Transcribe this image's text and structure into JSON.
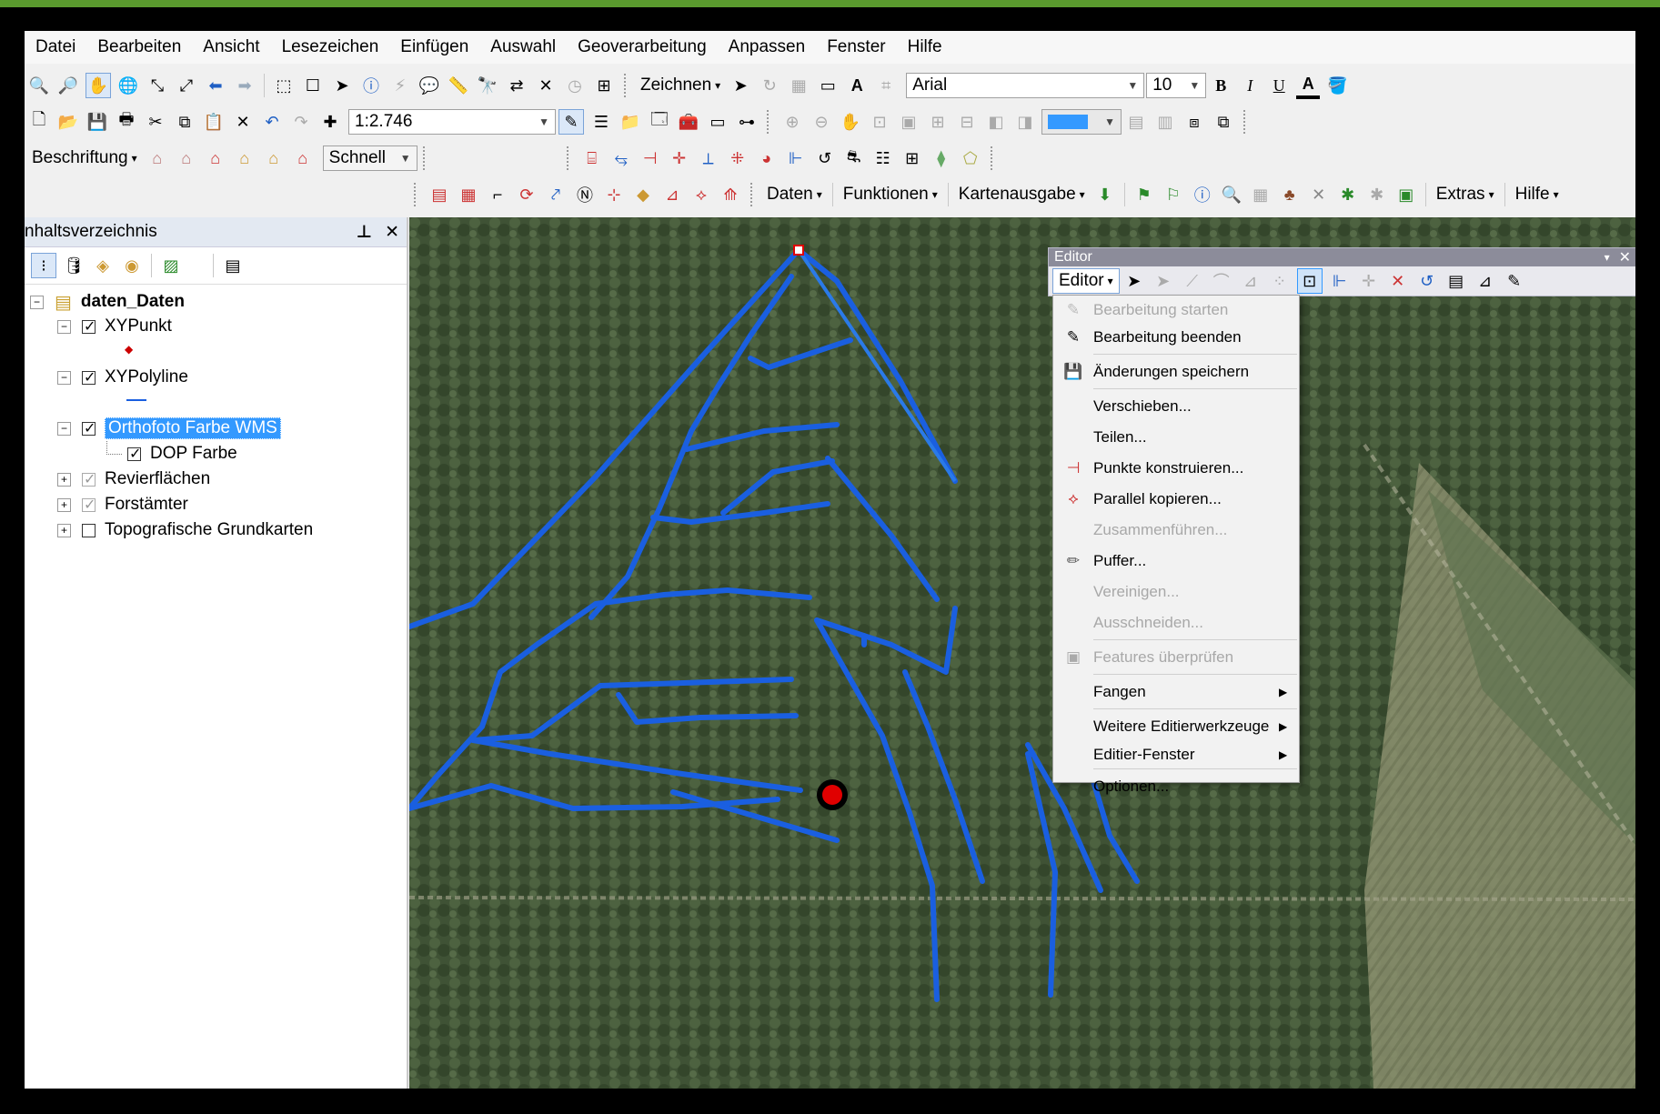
{
  "menu": [
    "Datei",
    "Bearbeiten",
    "Ansicht",
    "Lesezeichen",
    "Einfügen",
    "Auswahl",
    "Geoverarbeitung",
    "Anpassen",
    "Fenster",
    "Hilfe"
  ],
  "toolbar": {
    "zeichnen_label": "Zeichnen",
    "font_name": "Arial",
    "font_size": "10",
    "bold": "B",
    "italic": "I",
    "underline": "U",
    "text_color_glyph": "A",
    "scale": "1:2.746",
    "beschriftung_label": "Beschriftung",
    "label_quality": "Schnell",
    "daten_label": "Daten",
    "funktionen_label": "Funktionen",
    "kartenausgabe_label": "Kartenausgabe",
    "extras_label": "Extras",
    "hilfe_label": "Hilfe"
  },
  "toc": {
    "title": "nhaltsverzeichnis",
    "pin": "ᵖ",
    "close": "✕",
    "root": "daten_Daten",
    "layers": [
      {
        "label": "XYPunkt",
        "checked": true
      },
      {
        "label": "XYPolyline",
        "checked": true
      },
      {
        "label": "Orthofoto Farbe WMS",
        "checked": true
      },
      {
        "label": "DOP Farbe",
        "checked": true
      },
      {
        "label": "Revierflächen",
        "checked": true
      },
      {
        "label": "Forstämter",
        "checked": true
      },
      {
        "label": "Topografische Grundkarten",
        "checked": false
      }
    ]
  },
  "editor": {
    "title": "Editor",
    "menu_label": "Editor",
    "items": [
      {
        "label": "Bearbeitung starten",
        "disabled": true
      },
      {
        "label": "Bearbeitung beenden",
        "disabled": false
      },
      {
        "label": "Änderungen speichern",
        "disabled": false
      },
      {
        "label": "Verschieben...",
        "disabled": false
      },
      {
        "label": "Teilen...",
        "disabled": false
      },
      {
        "label": "Punkte konstruieren...",
        "disabled": false
      },
      {
        "label": "Parallel kopieren...",
        "disabled": false
      },
      {
        "label": "Zusammenführen...",
        "disabled": true
      },
      {
        "label": "Puffer...",
        "disabled": false
      },
      {
        "label": "Vereinigen...",
        "disabled": true
      },
      {
        "label": "Ausschneiden...",
        "disabled": true
      },
      {
        "label": "Features überprüfen",
        "disabled": true
      },
      {
        "label": "Fangen",
        "disabled": false
      },
      {
        "label": "Weitere Editierwerkzeuge",
        "disabled": false
      },
      {
        "label": "Editier-Fenster",
        "disabled": false
      },
      {
        "label": "Optionen...",
        "disabled": false
      }
    ]
  },
  "colors": {
    "line": "#1a5fe0",
    "point": "#e00000",
    "selection": "#3399ff",
    "frame_top": "#5a9a2e"
  }
}
